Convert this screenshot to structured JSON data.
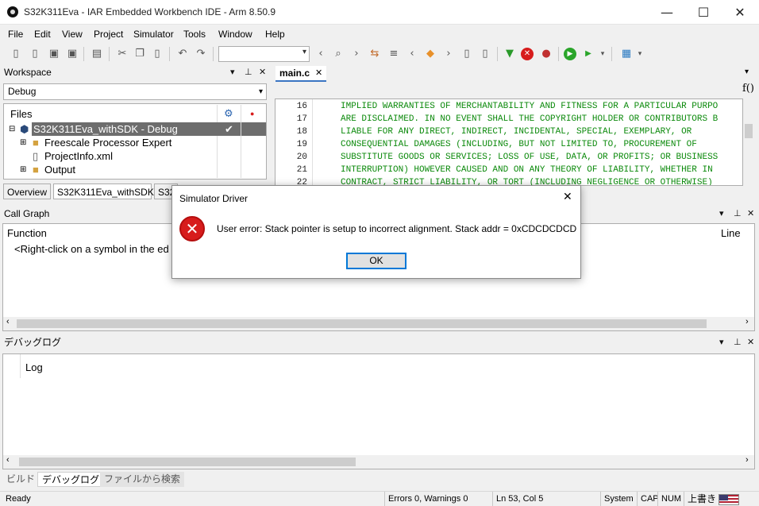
{
  "window": {
    "title": "S32K311Eva - IAR Embedded Workbench IDE - Arm 8.50.9"
  },
  "window_buttons": {
    "minimize": "—",
    "maximize": "☐",
    "close": "✕"
  },
  "menu": [
    "File",
    "Edit",
    "View",
    "Project",
    "Simulator",
    "Tools",
    "Window",
    "Help"
  ],
  "workspace": {
    "title": "Workspace",
    "config": "Debug",
    "header_files": "Files",
    "tree": [
      {
        "label": "S32K311Eva_withSDK - Debug",
        "selected": true
      },
      {
        "label": "Freescale Processor Expert"
      },
      {
        "label": "ProjectInfo.xml"
      },
      {
        "label": "Output"
      }
    ],
    "tabs": [
      "Overview",
      "S32K311Eva_withSDK",
      "S32"
    ]
  },
  "editor": {
    "tab": "main.c",
    "func_button": "f()",
    "lines": [
      {
        "n": "16",
        "t": "IMPLIED WARRANTIES OF MERCHANTABILITY AND FITNESS FOR A PARTICULAR PURPO"
      },
      {
        "n": "17",
        "t": "ARE DISCLAIMED. IN NO EVENT SHALL THE COPYRIGHT HOLDER OR CONTRIBUTORS B"
      },
      {
        "n": "18",
        "t": "LIABLE FOR ANY DIRECT, INDIRECT, INCIDENTAL, SPECIAL, EXEMPLARY, OR"
      },
      {
        "n": "19",
        "t": "CONSEQUENTIAL DAMAGES (INCLUDING, BUT NOT LIMITED TO, PROCUREMENT OF"
      },
      {
        "n": "20",
        "t": "SUBSTITUTE GOODS OR SERVICES; LOSS OF USE, DATA, OR PROFITS; OR BUSINESS"
      },
      {
        "n": "21",
        "t": "INTERRUPTION) HOWEVER CAUSED AND ON ANY THEORY OF LIABILITY, WHETHER IN"
      },
      {
        "n": "22",
        "t": "CONTRACT, STRICT LIABILITY, OR TORT (INCLUDING NEGLIGENCE OR OTHERWISE)"
      }
    ]
  },
  "callgraph": {
    "title": "Call Graph",
    "col_function": "Function",
    "col_line": "Line",
    "hint": "<Right-click on a symbol in the ed"
  },
  "debuglog": {
    "title": "デバッグログ",
    "col_log": "Log"
  },
  "bottom_tabs": [
    "ビルド",
    "デバッグログ",
    "ファイルから検索"
  ],
  "status": {
    "ready": "Ready",
    "errors": "Errors 0, Warnings 0",
    "position": "Ln 53, Col 5",
    "system": "System",
    "cap": "CAP",
    "num": "NUM",
    "ovr": "上書き"
  },
  "dialog": {
    "title": "Simulator Driver",
    "message": "User error: Stack pointer is setup to incorrect alignment.  Stack addr = 0xCDCDCDCD",
    "ok": "OK",
    "error_glyph": "✕"
  },
  "colors": {
    "comment": "#0c8a0c",
    "selection": "#6d6d6d",
    "accent": "#0078d7"
  }
}
